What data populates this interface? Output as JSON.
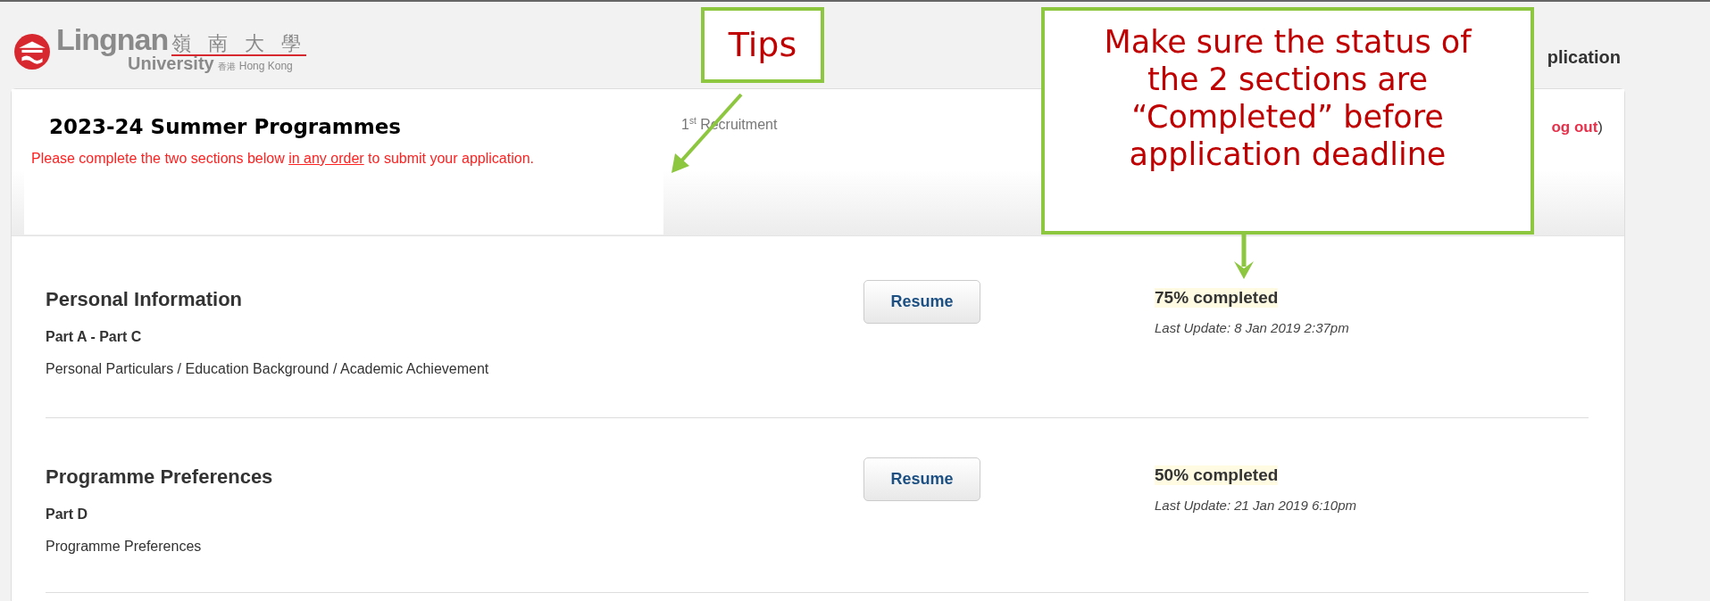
{
  "header": {
    "logo": {
      "name": "Lingnan",
      "chinese_name": "嶺 南 大 學",
      "subtitle": "University",
      "location_chinese": "香港",
      "location": "Hong Kong"
    },
    "title_fragment": "plication"
  },
  "application": {
    "programme": "2023-24 Summer Programmes",
    "instruction_before": "Please complete the two sections below ",
    "instruction_underlined": "in any order",
    "instruction_after": " to submit your application.",
    "recruitment": "1$^{st}$ Recruitment",
    "logout_link": "og out",
    "logout_close": ")"
  },
  "sections": [
    {
      "title": "Personal Information",
      "part": "Part A - Part C",
      "description": "Personal Particulars / Education Background / Academic Achievement",
      "button": "Resume",
      "status": "75% completed",
      "last_update": "Last Update: 8 Jan 2019 2:37pm"
    },
    {
      "title": "Programme Preferences",
      "part": "Part D",
      "description": "Programme Preferences",
      "button": "Resume",
      "status": "50% completed",
      "last_update": "Last Update: 21 Jan 2019 6:10pm"
    }
  ],
  "annotations": [
    {
      "kind": "tips",
      "text": "Tips"
    },
    {
      "kind": "note",
      "text": "Make sure the status of the 2 sections are “Completed” before application deadline"
    }
  ]
}
